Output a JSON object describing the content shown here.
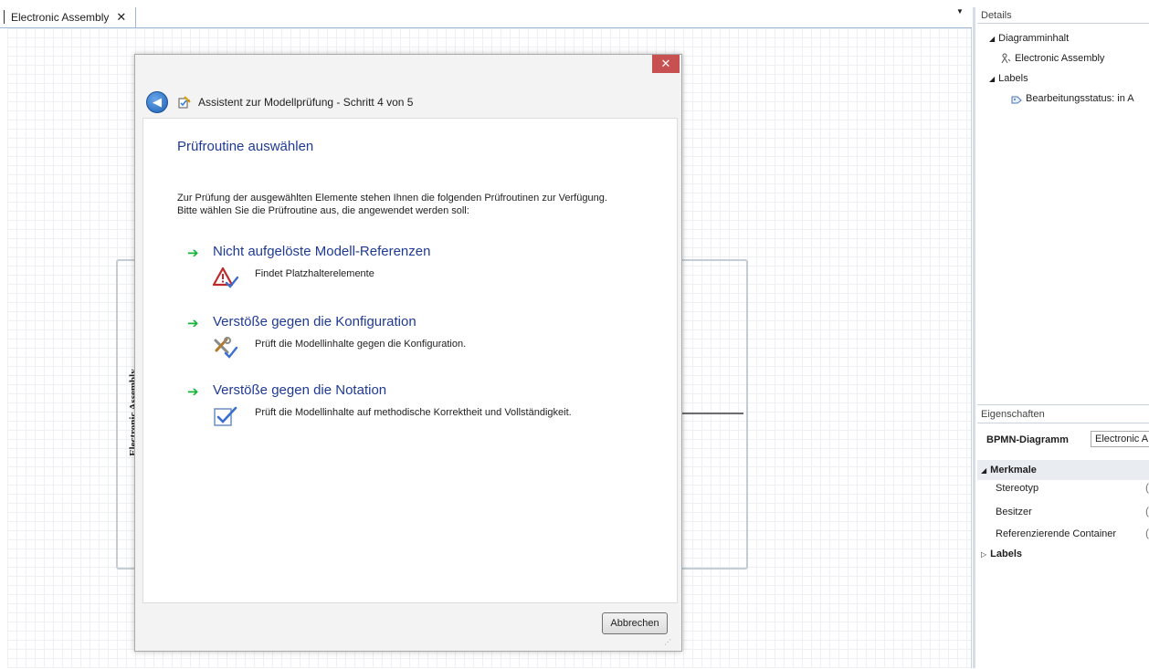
{
  "document_tab": {
    "label": "Electronic Assembly",
    "close_glyph": "✕",
    "dropdown_glyph": "▼"
  },
  "diagram": {
    "pool_label": "Electronic Assembly"
  },
  "dialog": {
    "close_glyph": "✕",
    "back_icon": "back-arrow-icon",
    "title": "Assistent zur Modellprüfung - Schritt 4 von 5",
    "heading": "Prüfroutine auswählen",
    "intro_line1": "Zur Prüfung der ausgewählten Elemente stehen Ihnen die folgenden Prüfroutinen zur Verfügung.",
    "intro_line2": "Bitte wählen Sie die Prüfroutine aus, die angewendet werden soll:",
    "options": [
      {
        "arrow": "➔",
        "title": "Nicht aufgelöste Modell-Referenzen",
        "description": "Findet Platzhalterelemente",
        "icon": "warning-check-icon"
      },
      {
        "arrow": "➔",
        "title": "Verstöße gegen die Konfiguration",
        "description": "Prüft die Modellinhalte gegen die Konfiguration.",
        "icon": "tools-check-icon"
      },
      {
        "arrow": "➔",
        "title": "Verstöße gegen die Notation",
        "description": "Prüft die Modellinhalte auf methodische Korrektheit und Vollständigkeit.",
        "icon": "document-check-icon"
      }
    ],
    "cancel_label": "Abbrechen"
  },
  "details": {
    "header": "Details",
    "tree": {
      "group1": "Diagramminhalt",
      "item1": "Electronic Assembly",
      "group2": "Labels",
      "item2": "Bearbeitungsstatus:  in A"
    }
  },
  "properties": {
    "header": "Eigenschaften",
    "type_label": "BPMN-Diagramm",
    "name_value": "Electronic A",
    "category1": "Merkmale",
    "props": [
      "Stereotyp",
      "Besitzer",
      "Referenzierende Container"
    ],
    "category2": "Labels"
  },
  "colors": {
    "accent_heading": "#1f3a93",
    "arrow_green": "#17b33b",
    "close_red": "#c75050"
  }
}
